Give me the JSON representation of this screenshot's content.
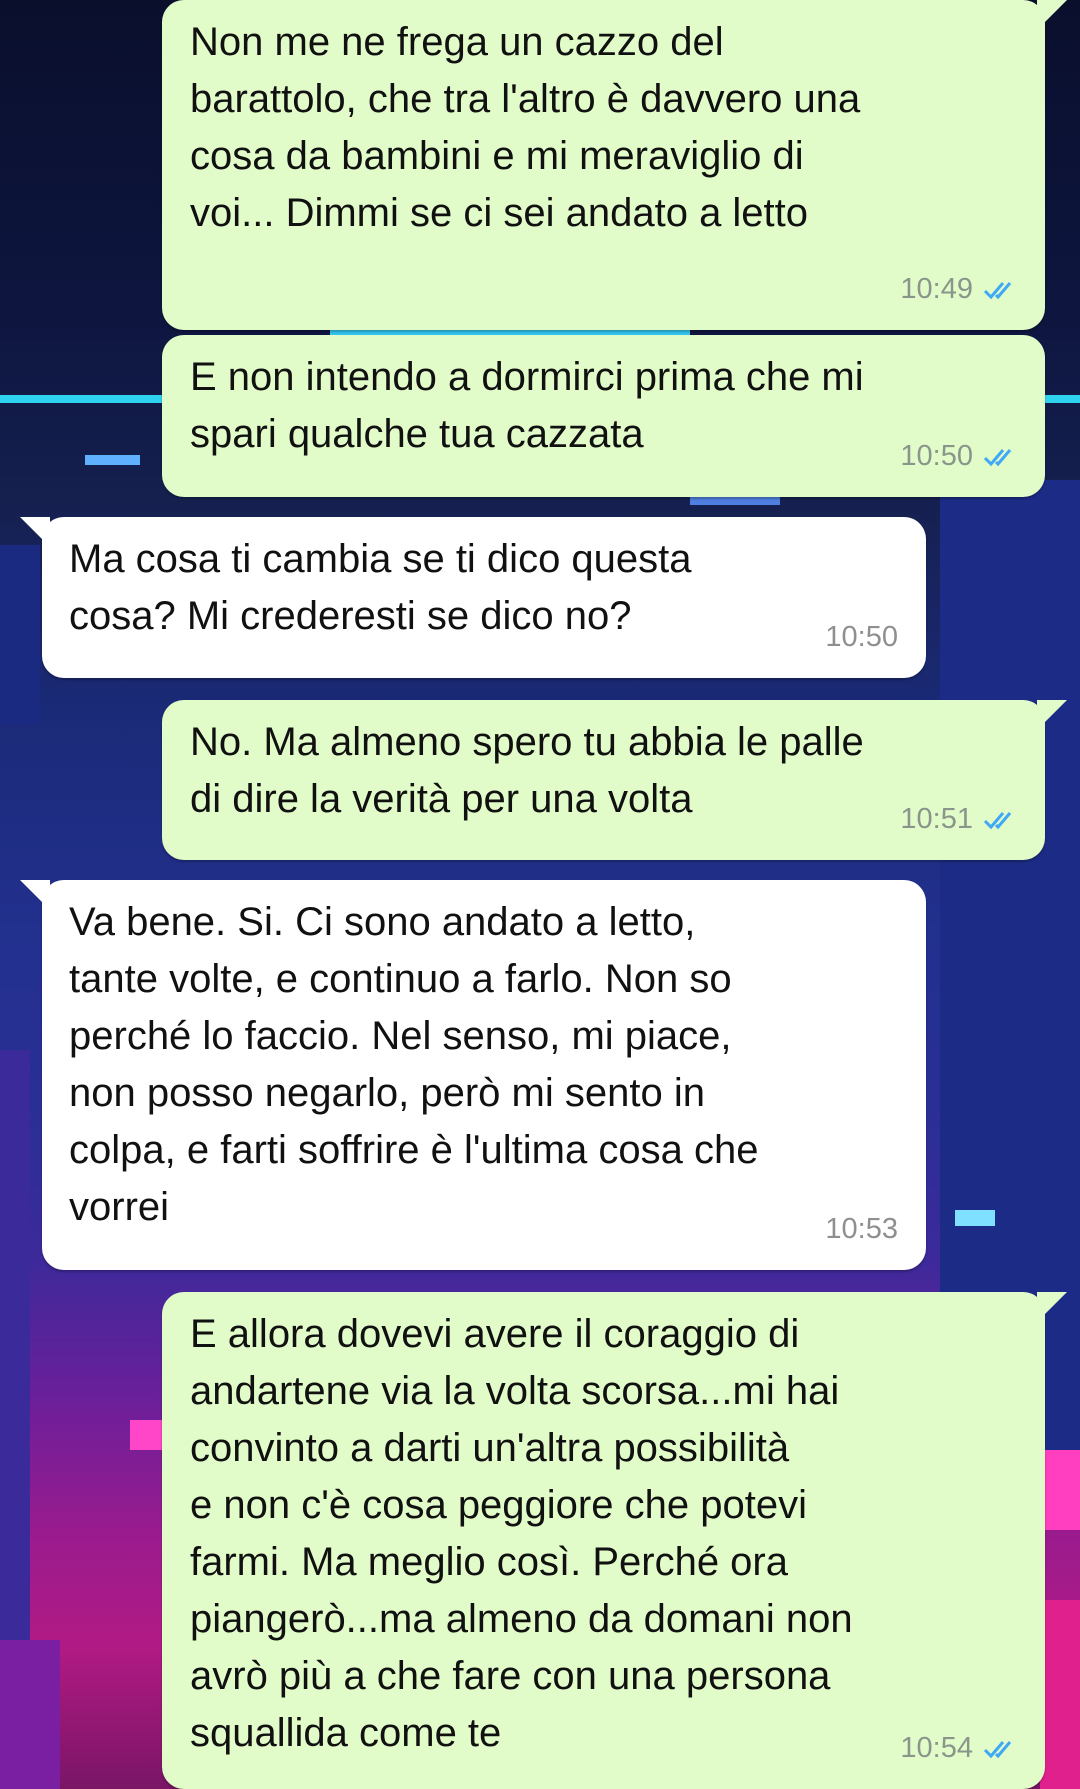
{
  "colors": {
    "outgoing_bubble": "#e2fcc9",
    "incoming_bubble": "#ffffff",
    "read_tick": "#3fa9f5"
  },
  "messages": [
    {
      "direction": "outgoing",
      "text": "Non me ne frega un cazzo del\nbarattolo, che tra l'altro è davvero una\ncosa da bambini e mi meraviglio di\nvoi... Dimmi se ci sei andato a letto",
      "time": "10:49",
      "status_icon": "double-check-read-icon"
    },
    {
      "direction": "outgoing",
      "text": "E non intendo a dormirci prima che mi\nspari qualche tua cazzata",
      "time": "10:50",
      "status_icon": "double-check-read-icon"
    },
    {
      "direction": "incoming",
      "text": "Ma cosa ti cambia se ti dico questa\ncosa? Mi crederesti se dico no?",
      "time": "10:50"
    },
    {
      "direction": "outgoing",
      "text": "No. Ma almeno spero tu abbia le palle\ndi dire la verità per una volta",
      "time": "10:51",
      "status_icon": "double-check-read-icon"
    },
    {
      "direction": "incoming",
      "text": "Va bene. Si. Ci sono andato a letto,\ntante volte, e continuo a farlo. Non so\nperché lo faccio. Nel senso, mi piace,\nnon posso negarlo, però mi sento in\ncolpa, e farti soffrire è l'ultima cosa che\nvorrei",
      "time": "10:53"
    },
    {
      "direction": "outgoing",
      "text": "E allora dovevi avere il coraggio di\nandartene via la volta scorsa...mi hai\nconvinto a darti un'altra possibilità\ne non c'è cosa peggiore che potevi\nfarmi. Ma meglio così. Perché ora\npiangerò...ma almeno da domani non\navrò più a che fare con una persona\nsquallida come te",
      "time": "10:54",
      "status_icon": "double-check-read-icon"
    }
  ]
}
